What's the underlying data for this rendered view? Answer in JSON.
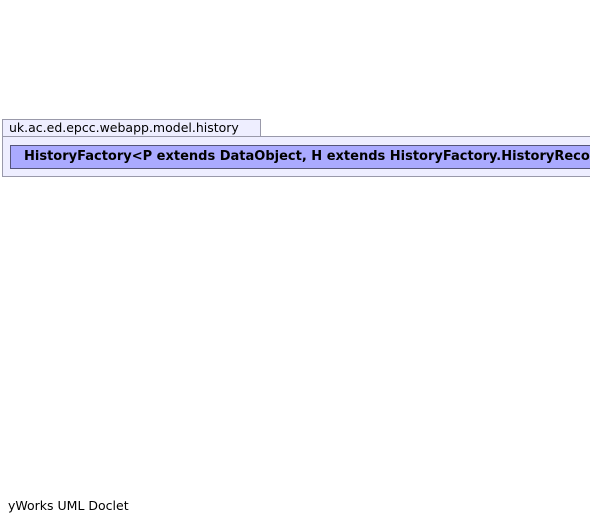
{
  "package": {
    "name": "uk.ac.ed.epcc.webapp.model.history"
  },
  "class": {
    "name": "HistoryFactory<P extends DataObject, H extends HistoryFactory.HistoryRecord<P>>"
  },
  "footer": {
    "text": "yWorks UML Doclet"
  },
  "colors": {
    "package_fill": "#eeeeff",
    "class_fill": "#aaaaff",
    "border": "#9999aa"
  }
}
